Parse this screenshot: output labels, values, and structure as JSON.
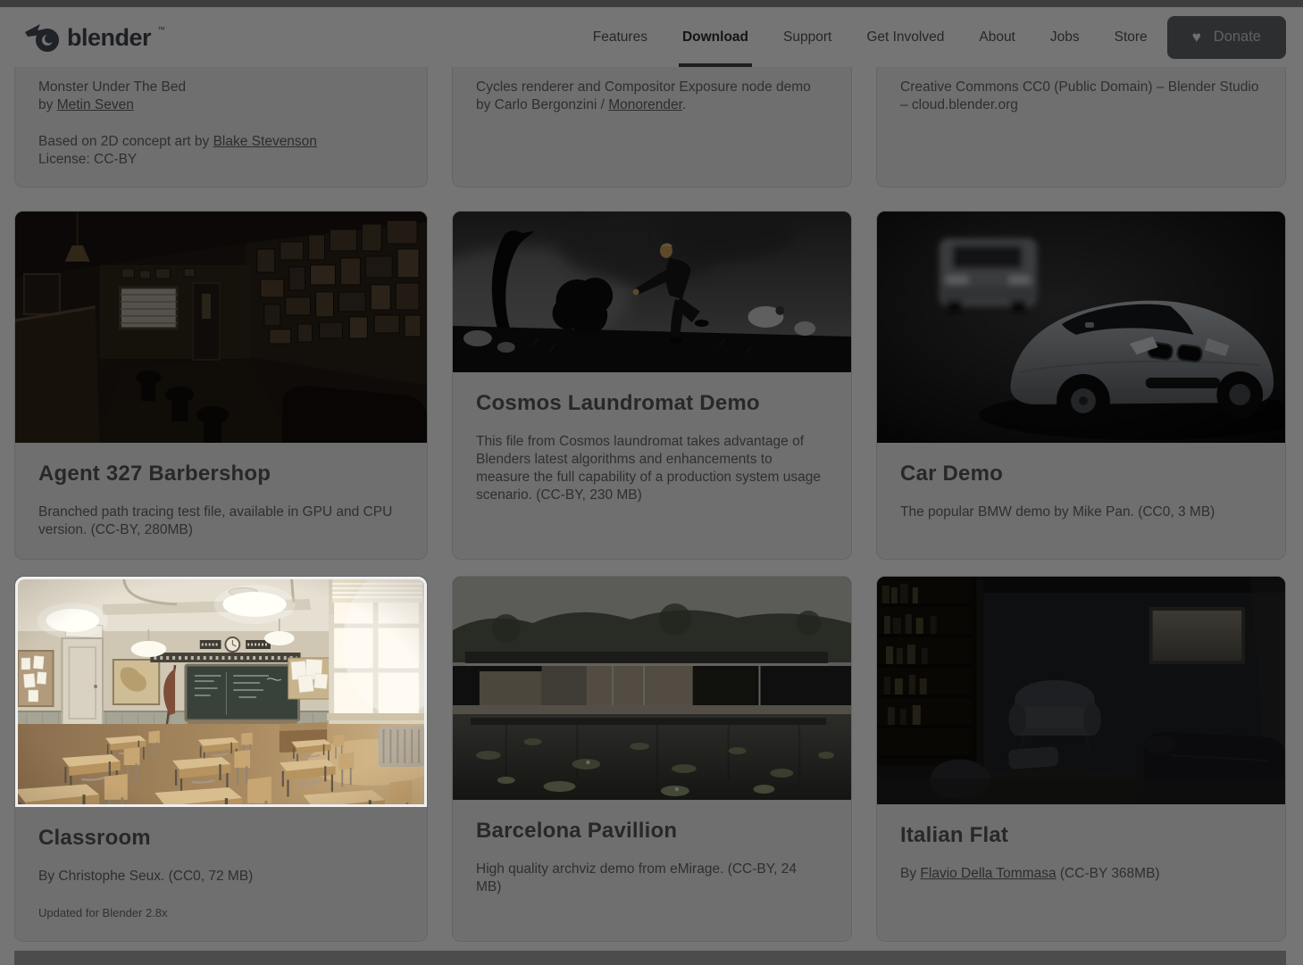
{
  "nav": {
    "brand": "blender",
    "brand_tm": "™",
    "items": [
      "Features",
      "Download",
      "Support",
      "Get Involved",
      "About",
      "Jobs",
      "Store"
    ],
    "active_item": "Download",
    "donate_label": "Donate"
  },
  "icons": {
    "heart-icon": "♥"
  },
  "colors": {
    "page_bg": "#ffffff",
    "card_bg": "#f1f1f1",
    "donate_bg": "#60646a",
    "dim_overlay": "rgba(0,0,0,0.54)",
    "highlight_border": "#f0f0f0",
    "footer_bg": "#a6a6a6"
  },
  "highlight": {
    "target": "classroom-thumbnail",
    "border_color": "#f0f0f0"
  },
  "cards": {
    "monster": {
      "line1": "Monster Under The Bed",
      "line2_prefix": "by ",
      "line2_link": "Metin Seven",
      "line3_prefix": "Based on 2D concept art by ",
      "line3_link": "Blake Stevenson",
      "line4": "License: CC-BY"
    },
    "exposure": {
      "line1": "Cycles renderer and Compositor Exposure node demo",
      "line2_prefix": "by Carlo Bergonzini / ",
      "line2_link": "Monorender",
      "line2_suffix": "."
    },
    "cc0": {
      "line1": "Creative Commons CC0 (Public Domain) – Blender Studio",
      "line2": "– cloud.blender.org"
    },
    "agent327": {
      "title": "Agent 327 Barbershop",
      "description": "Branched path tracing test file, available in GPU and CPU version. (CC-BY, 280MB)",
      "image_name": "agent-327-barbershop-render"
    },
    "cosmos": {
      "title": "Cosmos Laundromat Demo",
      "description": "This file from Cosmos laundromat takes advantage of Blenders latest algorithms and enhancements to measure the full capability of a production system usage scenario. (CC-BY, 230 MB)",
      "image_name": "cosmos-laundromat-render"
    },
    "car": {
      "title": "Car Demo",
      "description": "The popular BMW demo by Mike Pan. (CC0, 3 MB)",
      "image_name": "bmw-car-render"
    },
    "classroom": {
      "title": "Classroom",
      "description": "By Christophe Seux. (CC0, 72 MB)",
      "note": "Updated for Blender 2.8x",
      "image_name": "classroom-render",
      "highlighted": true
    },
    "barcelona": {
      "title": "Barcelona Pavillion",
      "description": "High quality archviz demo from eMirage. (CC-BY, 24 MB)",
      "image_name": "barcelona-pavillion-render"
    },
    "italian": {
      "title": "Italian Flat",
      "desc_prefix": "By ",
      "desc_link": "Flavio Della Tommasa",
      "desc_suffix": " (CC-BY 368MB)",
      "image_name": "italian-flat-render"
    }
  }
}
